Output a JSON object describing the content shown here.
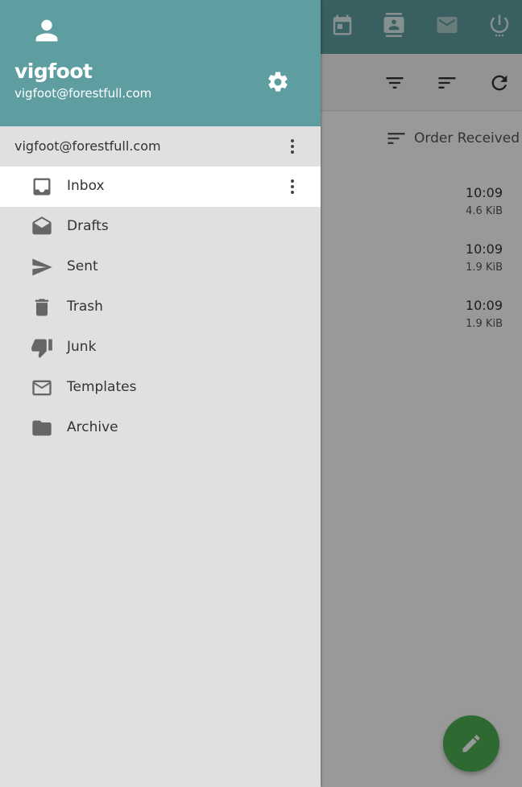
{
  "app": {
    "topbar_icons": [
      "calendar-icon",
      "contacts-icon",
      "mail-icon",
      "power-icon"
    ],
    "toolbar_icons": [
      "filter-icon",
      "sort-icon",
      "refresh-icon"
    ],
    "sort_label": "Order Received",
    "messages": [
      {
        "time": "10:09",
        "size": "4.6 KiB"
      },
      {
        "time": "10:09",
        "size": "1.9 KiB"
      },
      {
        "time": "10:09",
        "size": "1.9 KiB"
      }
    ],
    "fab_icon": "pencil-icon"
  },
  "drawer": {
    "user": {
      "name": "vigfoot",
      "email": "vigfoot@forestfull.com",
      "avatar_icon": "person-icon"
    },
    "settings_icon": "gear-icon",
    "account_label": "vigfoot@forestfull.com",
    "folders": [
      {
        "label": "Inbox",
        "icon": "inbox-icon",
        "active": true
      },
      {
        "label": "Drafts",
        "icon": "drafts-icon",
        "active": false
      },
      {
        "label": "Sent",
        "icon": "send-icon",
        "active": false
      },
      {
        "label": "Trash",
        "icon": "trash-icon",
        "active": false
      },
      {
        "label": "Junk",
        "icon": "thumb-down-icon",
        "active": false
      },
      {
        "label": "Templates",
        "icon": "envelope-icon",
        "active": false
      },
      {
        "label": "Archive",
        "icon": "folder-icon",
        "active": false
      }
    ]
  },
  "colors": {
    "header": "#5f9ea0",
    "drawer_bg": "#e0e0e0",
    "fab": "#4caf50",
    "icon": "#666666"
  }
}
